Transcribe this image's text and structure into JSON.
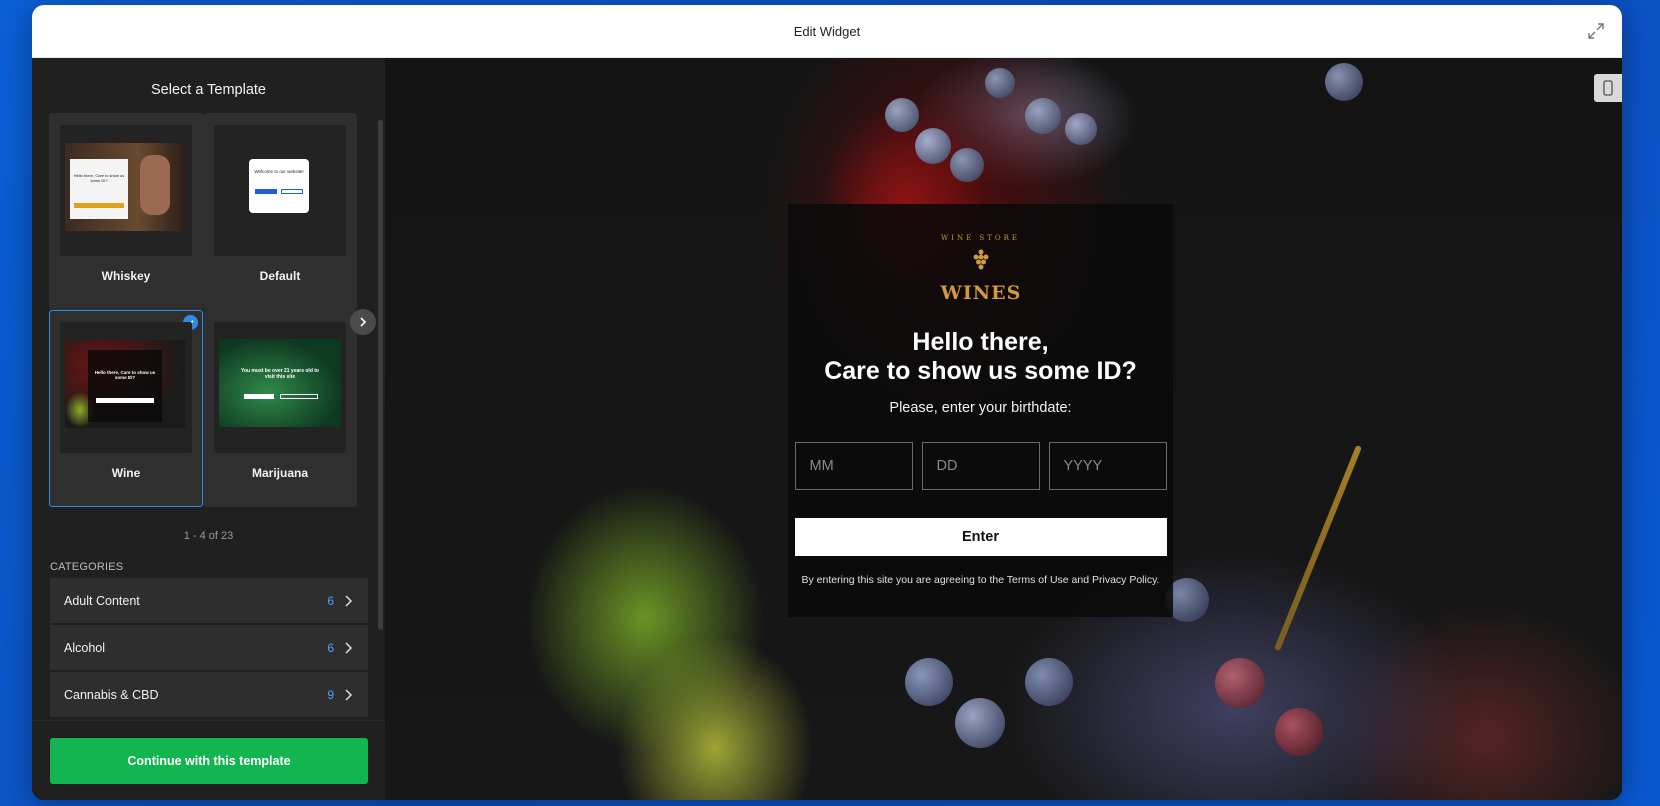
{
  "window": {
    "title": "Edit Widget"
  },
  "sidebar": {
    "title": "Select a Template",
    "templates": [
      {
        "label": "Whiskey",
        "selected": false
      },
      {
        "label": "Default",
        "selected": false
      },
      {
        "label": "Wine",
        "selected": true
      },
      {
        "label": "Marijuana",
        "selected": false
      }
    ],
    "thumbs": {
      "whiskey_text": "Hello there, Care to show us some ID?",
      "default_text": "Welcome to our website!",
      "wine_text": "Hello there, Care to show us some ID?",
      "marijuana_text": "You must be over 21 years old to visit this site"
    },
    "pager": "1 - 4 of 23",
    "categories_title": "CATEGORIES",
    "categories": [
      {
        "label": "Adult Content",
        "count": "6"
      },
      {
        "label": "Alcohol",
        "count": "6"
      },
      {
        "label": "Cannabis & CBD",
        "count": "9"
      }
    ],
    "continue_label": "Continue with this template"
  },
  "preview": {
    "logo_ring": "WINE STORE",
    "logo_word": "WINES",
    "heading_line1": "Hello there,",
    "heading_line2": "Care to show us some ID?",
    "subtitle": "Please, enter your birthdate:",
    "placeholders": {
      "mm": "MM",
      "dd": "DD",
      "yyyy": "YYYY"
    },
    "enter_label": "Enter",
    "terms": "By entering this site you are agreeing to the Terms of Use and Privacy Policy."
  },
  "colors": {
    "accent_blue": "#2f8be6",
    "continue_green": "#12b54f",
    "logo_gold": "#d19a3a"
  }
}
